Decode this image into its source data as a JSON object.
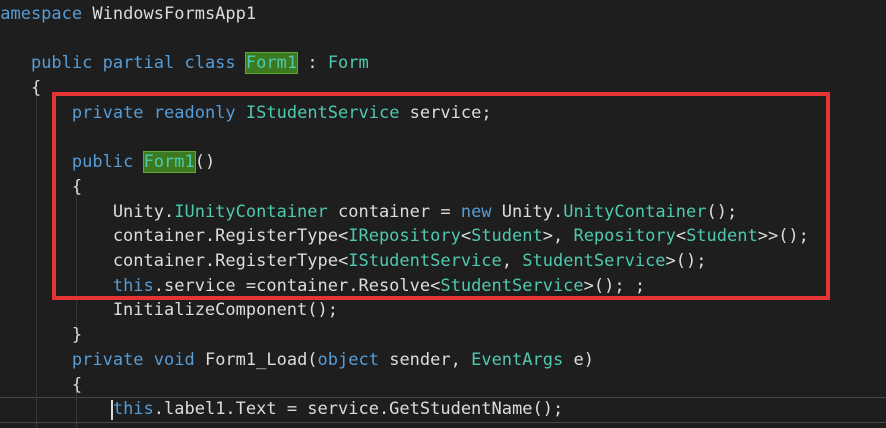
{
  "editor": {
    "lines": [
      [
        [
          "kw",
          "namespace"
        ],
        [
          "plain",
          " WindowsFormsApp1"
        ]
      ],
      [
        [
          "plain",
          "{"
        ]
      ],
      [
        [
          "plain",
          "    "
        ],
        [
          "kw",
          "public partial class"
        ],
        [
          "plain",
          " "
        ],
        [
          "hl",
          "Form1"
        ],
        [
          "plain",
          " : "
        ],
        [
          "type",
          "Form"
        ]
      ],
      [
        [
          "plain",
          "    {"
        ]
      ],
      [
        [
          "plain",
          "        "
        ],
        [
          "kw",
          "private readonly"
        ],
        [
          "plain",
          " "
        ],
        [
          "type",
          "IStudentService"
        ],
        [
          "plain",
          " service;"
        ]
      ],
      [
        [
          "plain",
          ""
        ]
      ],
      [
        [
          "plain",
          "        "
        ],
        [
          "kw",
          "public"
        ],
        [
          "plain",
          " "
        ],
        [
          "hl",
          "Form1"
        ],
        [
          "plain",
          "()"
        ]
      ],
      [
        [
          "plain",
          "        {"
        ]
      ],
      [
        [
          "plain",
          "            Unity."
        ],
        [
          "type",
          "IUnityContainer"
        ],
        [
          "plain",
          " container = "
        ],
        [
          "kw",
          "new"
        ],
        [
          "plain",
          " Unity."
        ],
        [
          "type",
          "UnityContainer"
        ],
        [
          "plain",
          "();"
        ]
      ],
      [
        [
          "plain",
          "            container.RegisterType<"
        ],
        [
          "type",
          "IRepository"
        ],
        [
          "plain",
          "<"
        ],
        [
          "type",
          "Student"
        ],
        [
          "plain",
          ">, "
        ],
        [
          "type",
          "Repository"
        ],
        [
          "plain",
          "<"
        ],
        [
          "type",
          "Student"
        ],
        [
          "plain",
          ">>();"
        ]
      ],
      [
        [
          "plain",
          "            container.RegisterType<"
        ],
        [
          "type",
          "IStudentService"
        ],
        [
          "plain",
          ", "
        ],
        [
          "type",
          "StudentService"
        ],
        [
          "plain",
          ">();"
        ]
      ],
      [
        [
          "plain",
          "            "
        ],
        [
          "kw",
          "this"
        ],
        [
          "plain",
          ".service =container.Resolve<"
        ],
        [
          "type",
          "StudentService"
        ],
        [
          "plain",
          ">(); ;"
        ]
      ],
      [
        [
          "plain",
          "            InitializeComponent();"
        ]
      ],
      [
        [
          "plain",
          "        }"
        ]
      ],
      [
        [
          "plain",
          "        "
        ],
        [
          "kw",
          "private void"
        ],
        [
          "plain",
          " Form1_Load("
        ],
        [
          "kw",
          "object"
        ],
        [
          "plain",
          " sender, "
        ],
        [
          "type",
          "EventArgs"
        ],
        [
          "plain",
          " e)"
        ]
      ],
      [
        [
          "plain",
          "        {"
        ]
      ],
      [
        [
          "plain",
          "            "
        ],
        [
          "kw",
          "this"
        ],
        [
          "plain",
          ".label1.Text = service.GetStudentName();"
        ]
      ]
    ]
  },
  "colors": {
    "background": "#1e1e1e",
    "keyword": "#569cd6",
    "type": "#4ec9b0",
    "text": "#dcdcdc",
    "highlight_box": "#e63333",
    "reference_highlight": "#3b7a1f"
  }
}
